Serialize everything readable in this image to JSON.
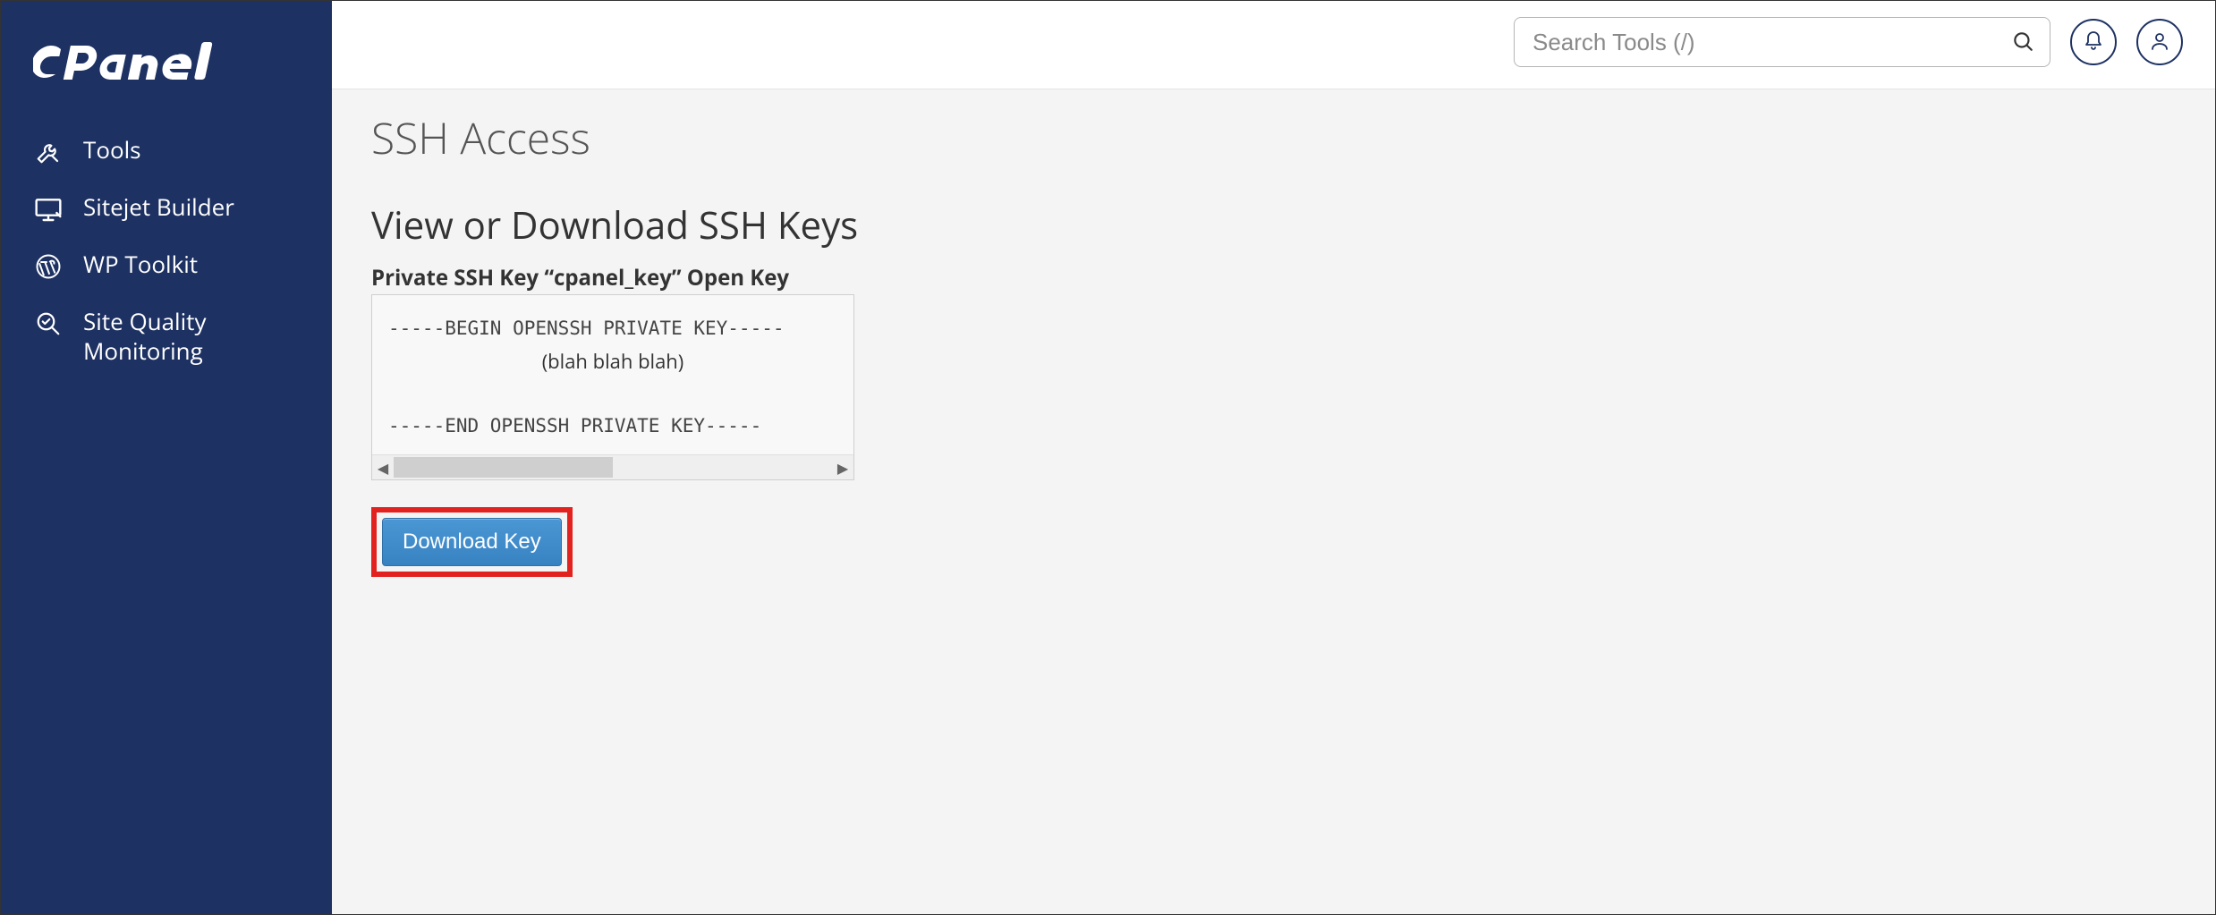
{
  "brand": "cPanel",
  "sidebar": {
    "items": [
      {
        "label": "Tools",
        "icon": "tools-icon"
      },
      {
        "label": "Sitejet Builder",
        "icon": "sitejet-icon"
      },
      {
        "label": "WP Toolkit",
        "icon": "wordpress-icon"
      },
      {
        "label": "Site Quality Monitoring",
        "icon": "magnifier-check-icon"
      }
    ]
  },
  "topbar": {
    "search_placeholder": "Search Tools (/)",
    "bell_title": "Notifications",
    "user_title": "Account"
  },
  "page": {
    "title": "SSH Access",
    "section_title": "View or Download SSH Keys",
    "key_label": "Private SSH Key “cpanel_key” Open Key",
    "key_begin": "-----BEGIN OPENSSH PRIVATE KEY-----",
    "key_placeholder": "(blah blah blah)",
    "key_end": "-----END OPENSSH PRIVATE KEY-----",
    "download_label": "Download Key"
  }
}
